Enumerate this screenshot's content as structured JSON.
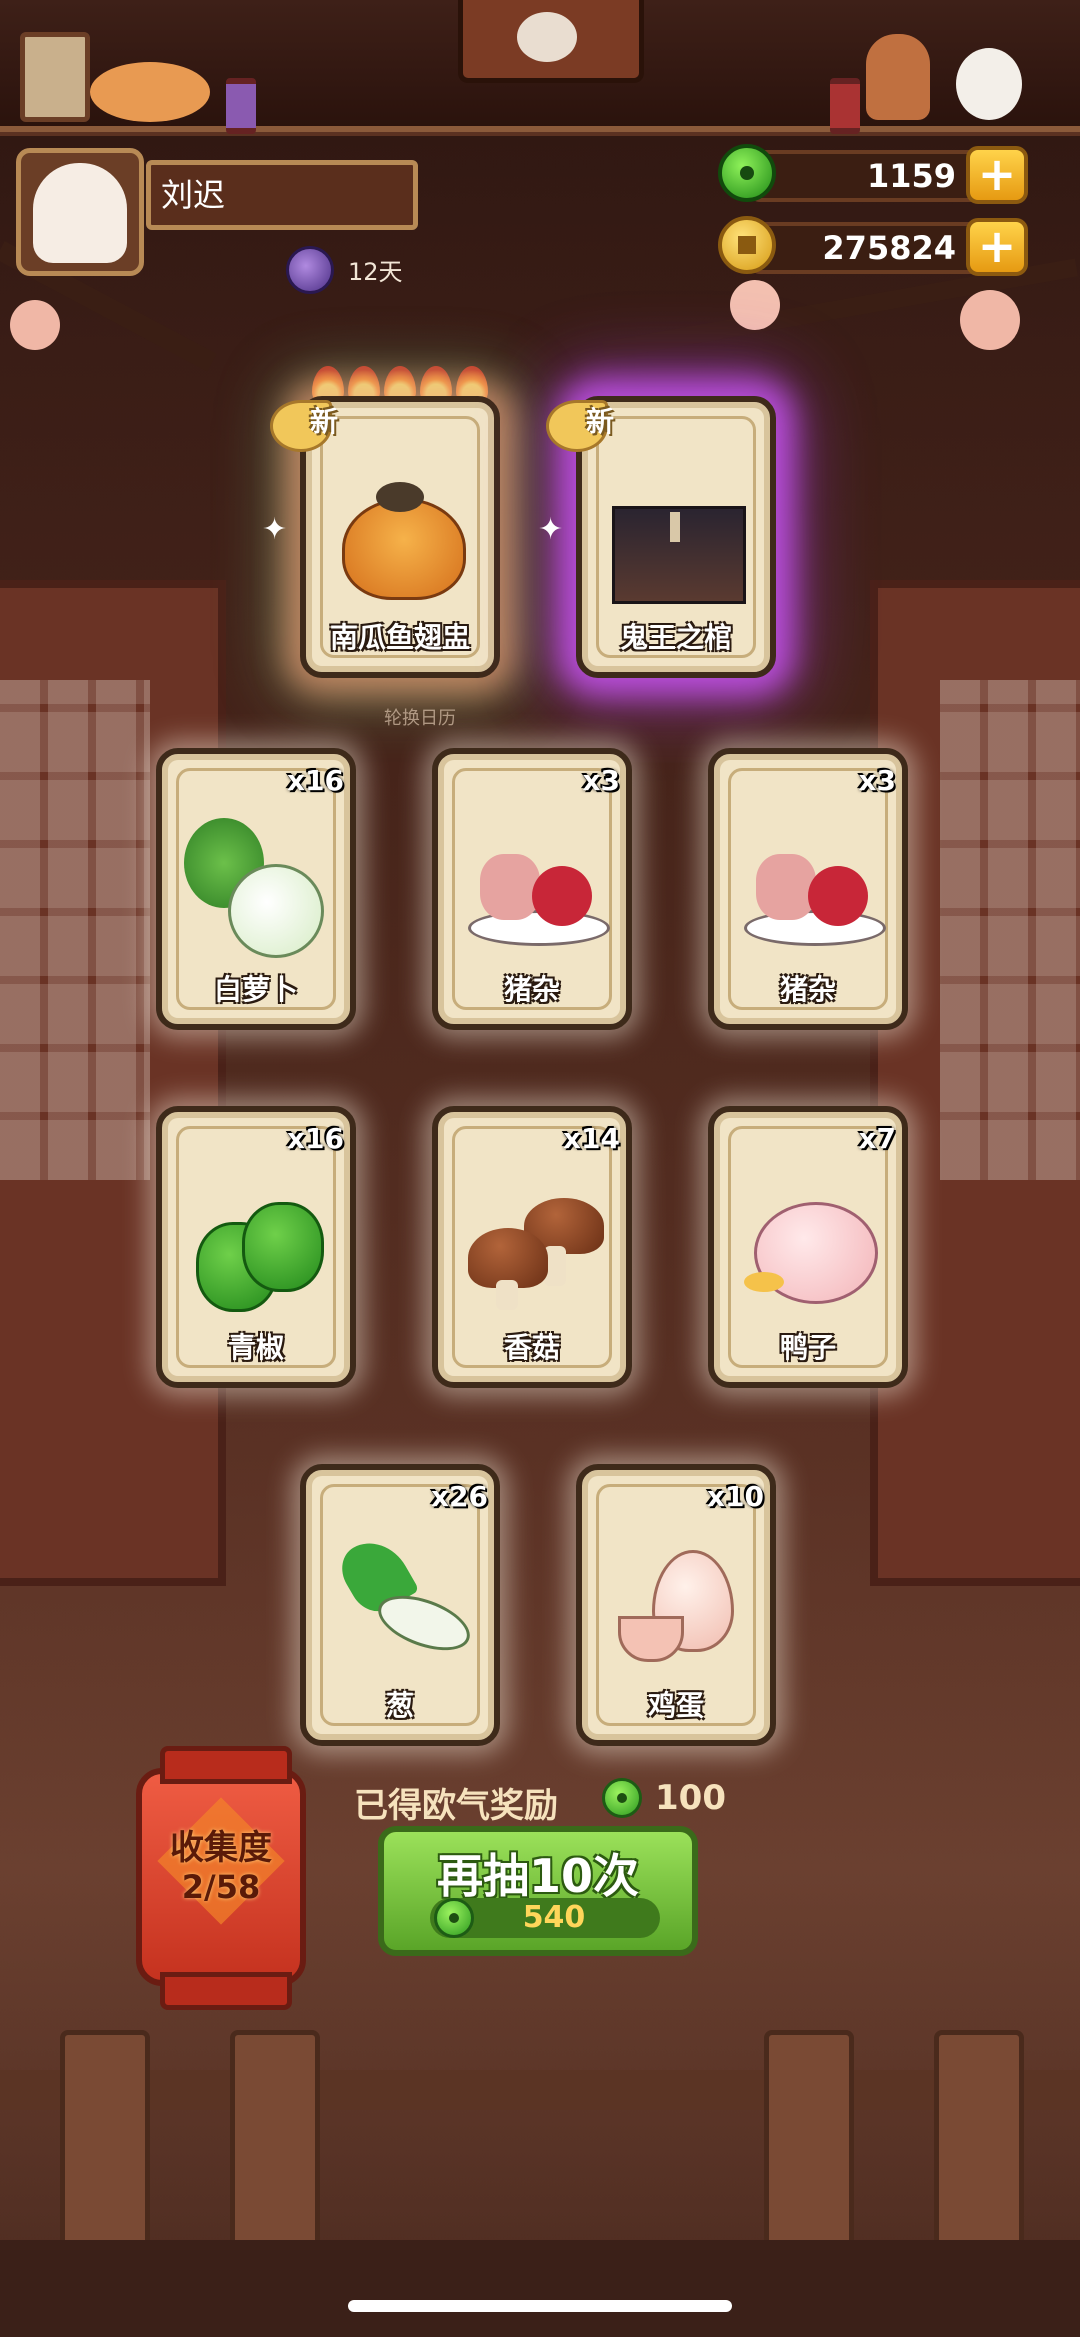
{
  "player": {
    "name": "刘迟",
    "days": "12天"
  },
  "currency": {
    "jade": "1159",
    "coins": "275824",
    "plus": "+"
  },
  "calendar_label": "轮换日历",
  "new_label": "新",
  "featured": [
    {
      "name": "南瓜鱼翅盅",
      "glow": "rainbow",
      "flames": 5
    },
    {
      "name": "鬼王之棺",
      "glow": "purple"
    }
  ],
  "cards": [
    {
      "name": "白萝卜",
      "qty": "x16"
    },
    {
      "name": "猪杂",
      "qty": "x3"
    },
    {
      "name": "猪杂",
      "qty": "x3"
    },
    {
      "name": "青椒",
      "qty": "x16"
    },
    {
      "name": "香菇",
      "qty": "x14"
    },
    {
      "name": "鸭子",
      "qty": "x7"
    },
    {
      "name": "葱",
      "qty": "x26"
    },
    {
      "name": "鸡蛋",
      "qty": "x10"
    }
  ],
  "reward": {
    "text": "已得欧气奖励",
    "amount": "100"
  },
  "collection": {
    "label": "收集度",
    "progress": "2/58"
  },
  "redraw": {
    "label": "再抽10次",
    "cost": "540"
  },
  "colors": {
    "accent_green": "#5aa528",
    "gold": "#ffd34a",
    "lantern_red": "#c5321f"
  }
}
